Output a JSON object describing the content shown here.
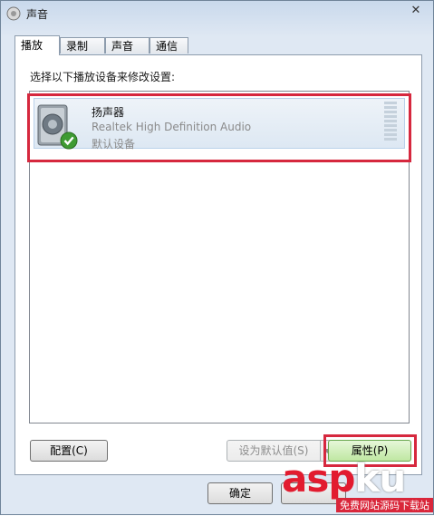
{
  "window": {
    "title": "声音",
    "close_label": "✕"
  },
  "tabs": [
    {
      "label": "播放",
      "active": true
    },
    {
      "label": "录制",
      "active": false
    },
    {
      "label": "声音",
      "active": false
    },
    {
      "label": "通信",
      "active": false
    }
  ],
  "panel": {
    "instructions": "选择以下播放设备来修改设置:"
  },
  "device": {
    "name": "扬声器",
    "driver": "Realtek High Definition Audio",
    "status": "默认设备",
    "icon": "speaker-icon",
    "status_icon": "check-icon"
  },
  "buttons": {
    "configure": "配置(C)",
    "set_default": "设为默认值(S)",
    "properties": "属性(P)",
    "ok": "确定"
  },
  "watermark": {
    "main_part1": "asp",
    "main_part2": "ku",
    "sub": "免费网站源码下载站"
  },
  "colors": {
    "highlight": "#d6283e",
    "accent_green": "#4caf50"
  }
}
